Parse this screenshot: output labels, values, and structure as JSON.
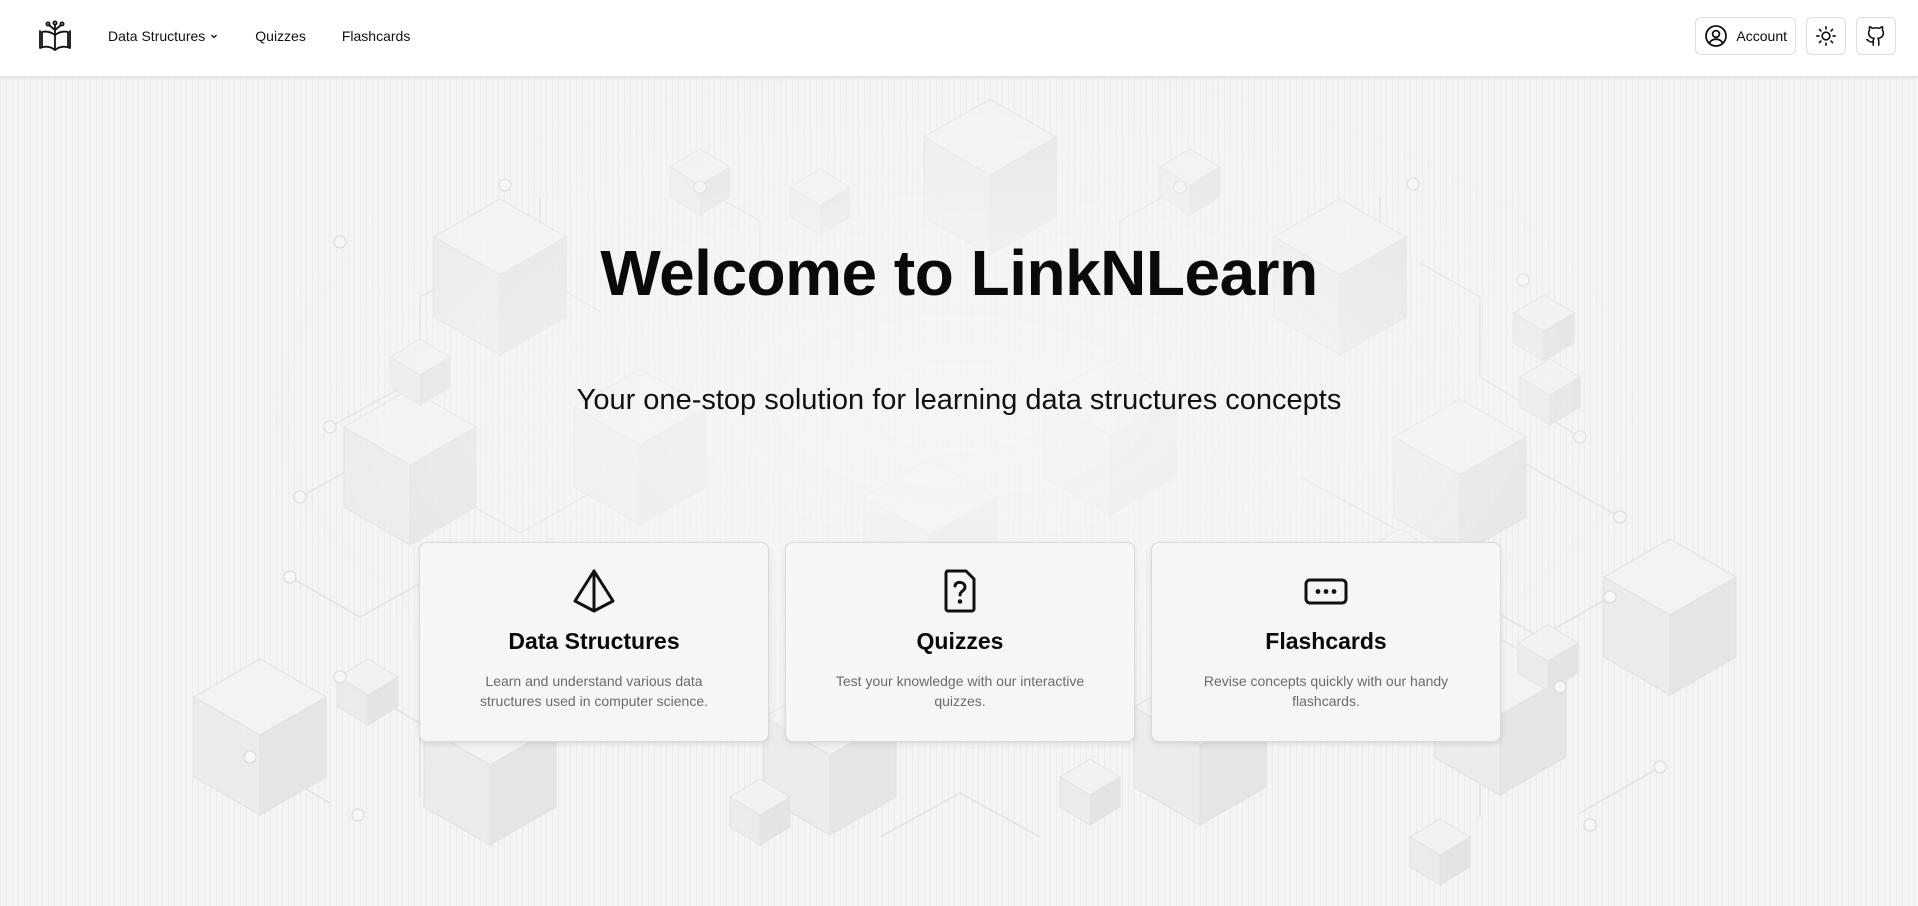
{
  "header": {
    "logo_icon": "open-book-icon",
    "nav": [
      {
        "label": "Data Structures",
        "has_dropdown": true
      },
      {
        "label": "Quizzes"
      },
      {
        "label": "Flashcards"
      }
    ],
    "account_label": "Account",
    "account_icon": "user-circle-icon",
    "theme_icon": "sun-icon",
    "github_icon": "github-icon"
  },
  "hero": {
    "title": "Welcome to LinkNLearn",
    "subtitle": "Your one-stop solution for learning data structures concepts"
  },
  "cards": [
    {
      "icon": "pyramid-icon",
      "title": "Data Structures",
      "description": "Learn and understand various data structures used in computer science."
    },
    {
      "icon": "file-question-icon",
      "title": "Quizzes",
      "description": "Test your knowledge with our interactive quizzes."
    },
    {
      "icon": "ellipsis-rectangle-icon",
      "title": "Flashcards",
      "description": "Revise concepts quickly with our handy flashcards."
    }
  ],
  "colors": {
    "background": "#f5f5f5",
    "text": "#0a0a0a",
    "muted_text": "#6b6b6b",
    "card_background": "#f6f6f6",
    "border": "#d9d9d9"
  }
}
